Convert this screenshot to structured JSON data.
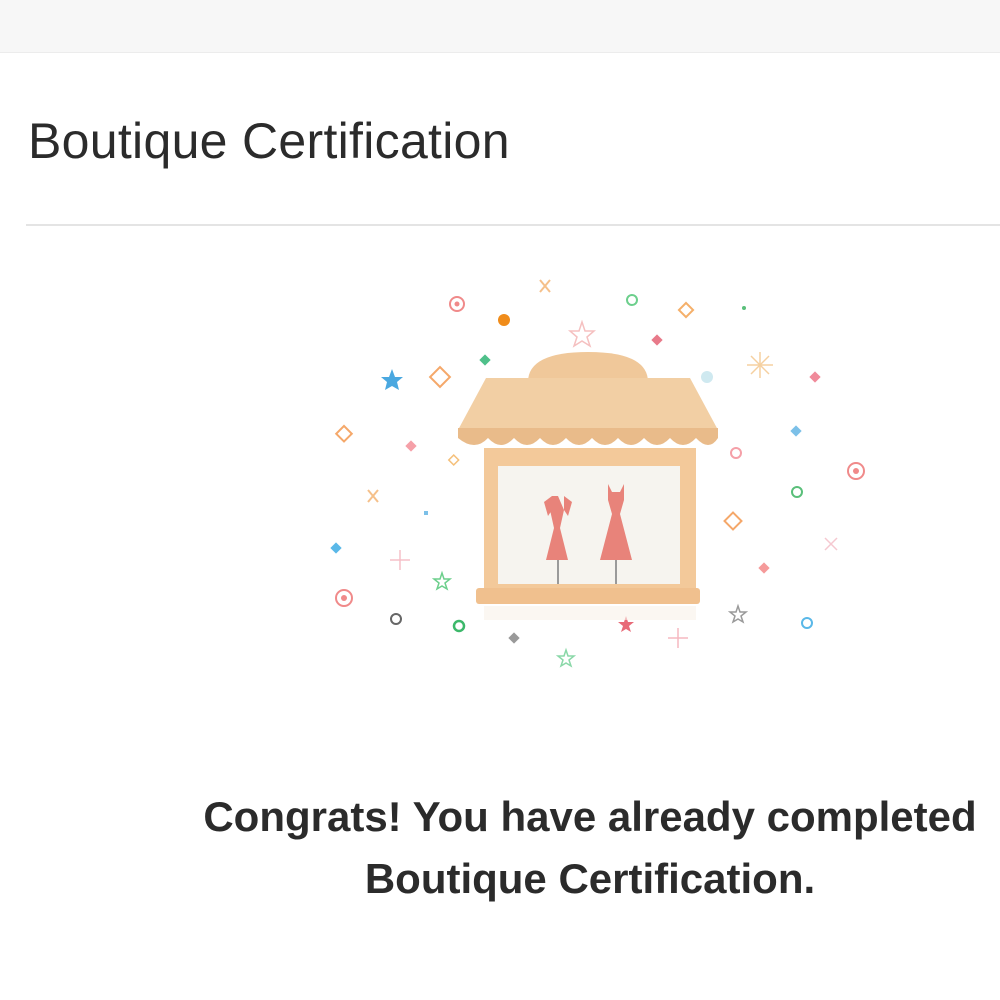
{
  "page": {
    "title": "Boutique Certification"
  },
  "message": {
    "line1": "Congrats! You have already completed",
    "line2": "Boutique Certification."
  },
  "illustration": {
    "icon": "boutique-storefront-icon",
    "colors": {
      "awning": "#f2c99c",
      "awning_shadow": "#e8b988",
      "window_bg": "#f6f4ef",
      "dress": "#e8837a"
    }
  }
}
